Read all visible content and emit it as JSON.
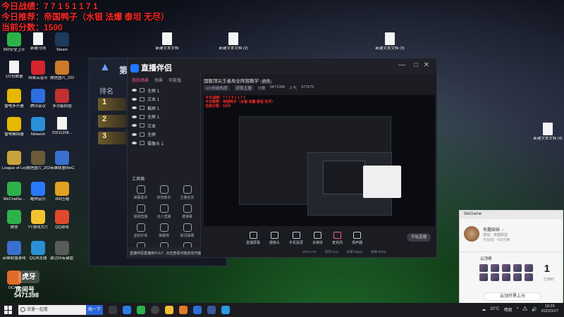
{
  "overlay": {
    "line1": "今日战绩：7 7 1 5 1 1 7 1",
    "line2": "今日推荐：帝国鸭子（水银 法爆 泰坦 无尽）",
    "line3": "当前分数：1500"
  },
  "desktop_icons": [
    {
      "label": "360安全卫士",
      "color": "#2db24a"
    },
    {
      "label": "新建马钱",
      "color": "file"
    },
    {
      "label": "Steam",
      "color": "#1b3a5c"
    },
    {
      "label": "1月份数据",
      "color": "file"
    },
    {
      "label": "网易云音乐",
      "color": "#d3252b"
    },
    {
      "label": "微信图片_2022027...",
      "color": "#cc7a2a"
    },
    {
      "label": "雷电多开器",
      "color": "#e6b800"
    },
    {
      "label": "腾讯会议",
      "color": "#2d6fe0"
    },
    {
      "label": "多功能抓图",
      "color": "#c23030"
    },
    {
      "label": "雷电模拟器",
      "color": "#e6b800"
    },
    {
      "label": "Network",
      "color": "#2a8fd6"
    },
    {
      "label": "20211208...",
      "color": "file"
    },
    {
      "label": "League of Legends",
      "color": "#c8a23c"
    },
    {
      "label": "微信图片_2022021...",
      "color": "#6a5a3a"
    },
    {
      "label": "英雄联盟WeGame版",
      "color": "#3a6fcf"
    },
    {
      "label": "WeChatSe...",
      "color": "#2db24a"
    },
    {
      "label": "酷狗音乐",
      "color": "#2979ff"
    },
    {
      "label": "360压缩",
      "color": "#e0a020"
    },
    {
      "label": "微信",
      "color": "#2db24a"
    },
    {
      "label": "YY游戏大厅",
      "color": "#f4c430"
    },
    {
      "label": "QQ游戏",
      "color": "#e04a2a"
    },
    {
      "label": "英雄联盟游戏",
      "color": "#3a6fcf"
    },
    {
      "label": "QQ浏览器",
      "color": "#2a8fd6"
    },
    {
      "label": "激活所有键盘设备",
      "color": "#5a5a5a"
    },
    {
      "label": "OCAM",
      "color": "#e06a2a"
    }
  ],
  "desktop_files": [
    {
      "label": "新建文本文档"
    },
    {
      "label": "新建文本文档 (2)"
    },
    {
      "label": "新建文本文档 (3)"
    },
    {
      "label": "新建文本文档 (4)"
    }
  ],
  "game_window": {
    "title": "第",
    "rank_label": "排名",
    "ranks": [
      "1",
      "2",
      "3"
    ]
  },
  "live_app": {
    "brand": "直播伴侣",
    "tabs": [
      "我的场景",
      "场景",
      "可能值"
    ],
    "sources": [
      "全屏 1",
      "文本 1",
      "截屏 1",
      "全屏 1",
      "文本",
      "全屏",
      "摄像头 1"
    ],
    "tools_header": "工具箱",
    "tools": [
      "弹幕助手",
      "房管助手",
      "主播任务",
      "视频直播",
      "点人直播",
      "渡弹幕",
      "虚拟形象",
      "弹幕库",
      "歌词弹幕",
      "直播",
      "",
      ""
    ],
    "tip": "直播伴侣直播用什么？ 点击查看可能走向可能直播",
    "room_title": "国服顶尖王者局全阵容教学",
    "room_tag": "游戏",
    "room_meta": [
      "1小时前热度",
      "获取主播",
      "分数",
      "5471398",
      "人气",
      "377676"
    ],
    "controls": [
      "直播屏幕",
      "摄像头",
      "手机投屏",
      "多媒体",
      "麦克风",
      "扬声器"
    ],
    "start_label": "开始直播",
    "stats": [
      "CPU:17%",
      "内存:41%",
      "码率:0kbps",
      "帧率:0FPS"
    ]
  },
  "wegame": {
    "header": "WeGame",
    "name": "有趣妹妹",
    "subline1": "游戏：英雄联盟",
    "subline2": "已在线：419分钟",
    "rank_label": "云顶榜",
    "count": "1",
    "count_label": "已用时",
    "pill_label": "云顶开黑上分"
  },
  "bottom_left": {
    "logo": "虎牙",
    "label": "房间号",
    "room_number": "5471398"
  },
  "taskbar": {
    "search_placeholder": "流量一起看",
    "search_button": "找一下",
    "temperature": "20°C",
    "weather": "晴朗",
    "time": "18:29",
    "date": "2022/3/27"
  }
}
